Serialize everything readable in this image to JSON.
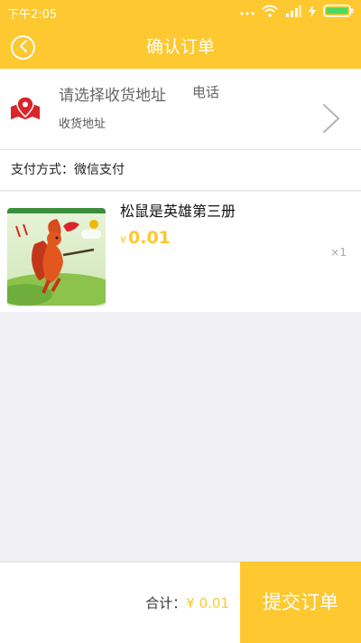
{
  "status_bar": {
    "time": "下午2:05"
  },
  "header": {
    "title": "确认订单"
  },
  "address": {
    "placeholder": "请选择收货地址",
    "phone_label": "电话",
    "address_label": "收货地址"
  },
  "payment": {
    "method_label": "支付方式：微信支付"
  },
  "product": {
    "name": "松鼠是英雄第三册",
    "currency": "¥",
    "price": "0.01",
    "quantity": "×1"
  },
  "footer": {
    "total_label": "合计：",
    "total_value": "¥ 0.01",
    "submit_label": "提交订单"
  },
  "colors": {
    "accent": "#fdc830",
    "pin": "#d9262b"
  }
}
